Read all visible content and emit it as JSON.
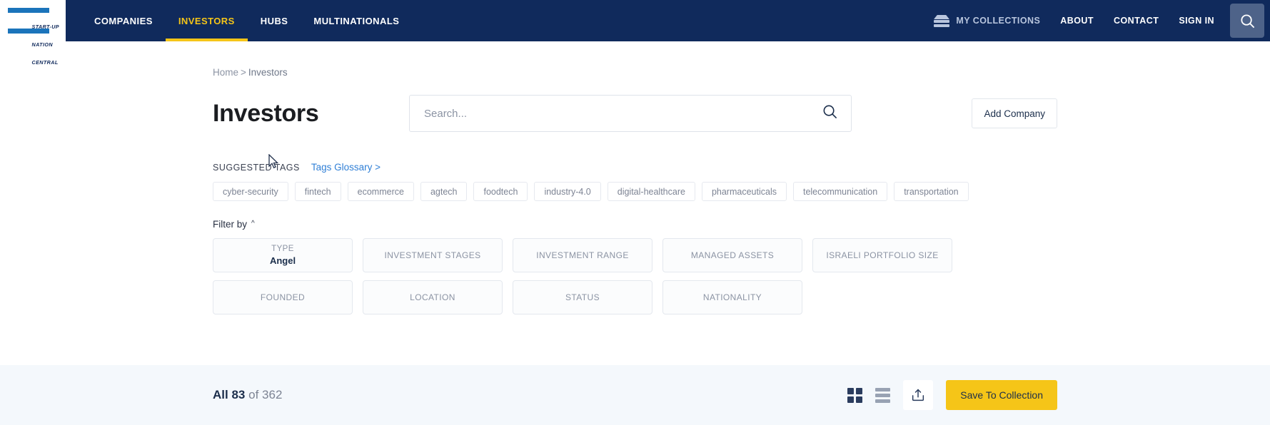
{
  "header": {
    "logo": {
      "line1": "START-UP",
      "line2": "NATION",
      "line3": "CENTRAL"
    },
    "nav_left": [
      {
        "label": "COMPANIES",
        "active": false
      },
      {
        "label": "INVESTORS",
        "active": true
      },
      {
        "label": "HUBS",
        "active": false
      },
      {
        "label": "MULTINATIONALS",
        "active": false
      }
    ],
    "nav_right": [
      {
        "label": "MY COLLECTIONS"
      },
      {
        "label": "ABOUT"
      },
      {
        "label": "CONTACT"
      },
      {
        "label": "SIGN IN"
      }
    ],
    "search_icon": "search-icon",
    "accent_color": "#f5c518",
    "nav_bg": "#102a5c"
  },
  "breadcrumb": {
    "home": "Home",
    "separator": ">",
    "current": "Investors"
  },
  "page": {
    "title": "Investors",
    "add_company_label": "Add Company"
  },
  "search": {
    "placeholder": "Search...",
    "value": "",
    "icon": "search-icon"
  },
  "tags": {
    "label": "SUGGESTED TAGS",
    "glossary_link": "Tags Glossary >",
    "items": [
      "cyber-security",
      "fintech",
      "ecommerce",
      "agtech",
      "foodtech",
      "industry-4.0",
      "digital-healthcare",
      "pharmaceuticals",
      "telecommunication",
      "transportation"
    ]
  },
  "filters": {
    "label": "Filter by",
    "chevron": "chevron-up-icon",
    "row1": [
      {
        "label": "TYPE",
        "value": "Angel",
        "selected": true
      },
      {
        "label": "INVESTMENT STAGES",
        "value": "",
        "selected": false
      },
      {
        "label": "INVESTMENT RANGE",
        "value": "",
        "selected": false
      },
      {
        "label": "MANAGED ASSETS",
        "value": "",
        "selected": false
      },
      {
        "label": "ISRAELI PORTFOLIO SIZE",
        "value": "",
        "selected": false
      }
    ],
    "row2": [
      {
        "label": "FOUNDED",
        "value": "",
        "selected": false
      },
      {
        "label": "LOCATION",
        "value": "",
        "selected": false
      },
      {
        "label": "STATUS",
        "value": "",
        "selected": false
      },
      {
        "label": "NATIONALITY",
        "value": "",
        "selected": false
      }
    ]
  },
  "footer": {
    "count_prefix": "All",
    "count_shown": "83",
    "count_of": "of",
    "count_total": "362",
    "grid_view_icon": "grid-view-icon",
    "list_view_icon": "list-view-icon",
    "share_icon": "share-upload-icon",
    "save_label": "Save To Collection",
    "save_color": "#f5c518",
    "bg_color": "#f4f8fc"
  }
}
